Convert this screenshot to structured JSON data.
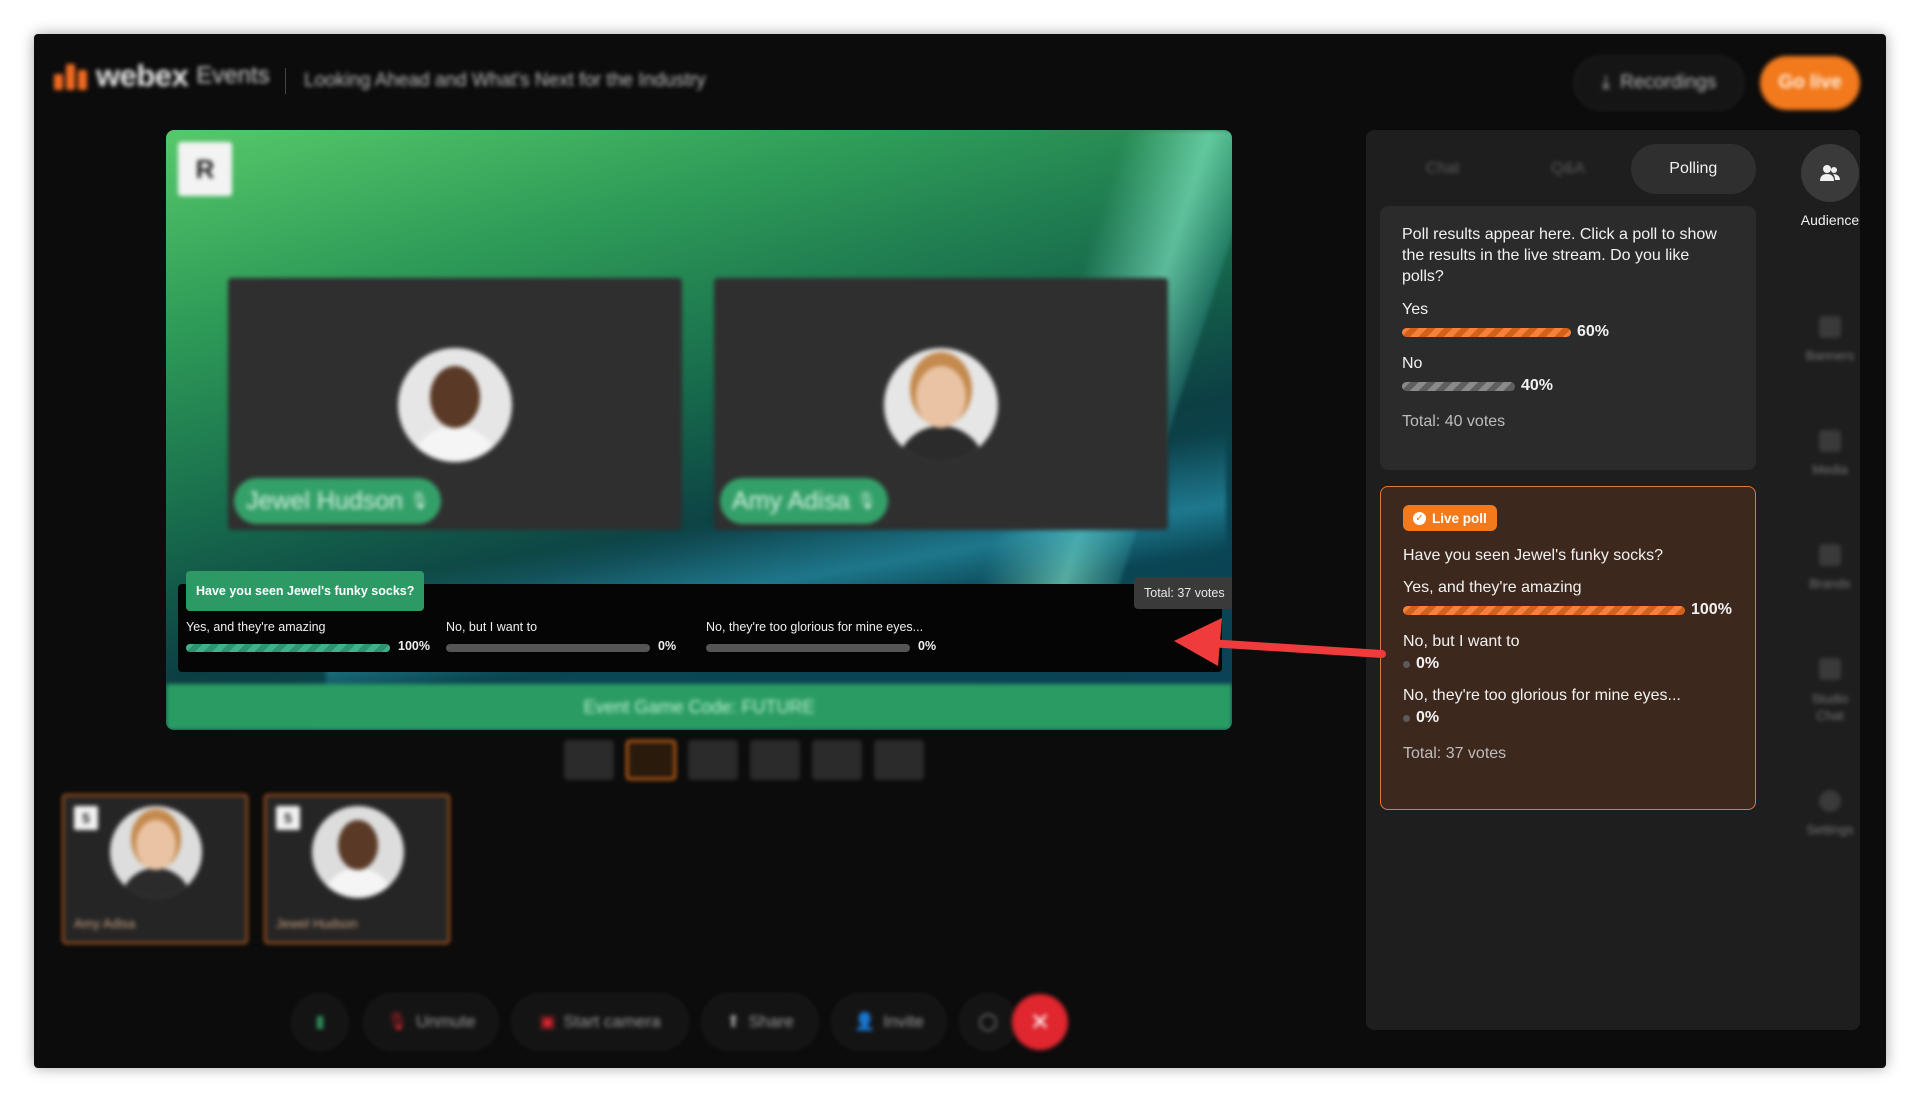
{
  "header": {
    "brand": "webex",
    "brand_suffix": "Events",
    "event_title": "Looking Ahead and What's Next for the Industry",
    "recordings_label": "Recordings",
    "go_live_label": "Go live"
  },
  "stage": {
    "presenters": [
      {
        "name": "Jewel Hudson"
      },
      {
        "name": "Amy Adisa"
      }
    ],
    "poll": {
      "question": "Have you seen Jewel's funky socks?",
      "total": "Total: 37 votes",
      "options": [
        {
          "label": "Yes, and they're amazing",
          "percent_label": "100%",
          "percent": 100
        },
        {
          "label": "No, but I want to",
          "percent_label": "0%",
          "percent": 0
        },
        {
          "label": "No, they're too glorious for mine eyes...",
          "percent_label": "0%",
          "percent": 0
        }
      ]
    },
    "game_code": "Event Game Code: FUTURE"
  },
  "thumbnails": [
    {
      "number": "5",
      "name": "Amy Adisa"
    },
    {
      "number": "5",
      "name": "Jewel Hudson"
    }
  ],
  "controls": {
    "unmute": "Unmute",
    "start_camera": "Start camera",
    "share": "Share",
    "invite": "Invite"
  },
  "panel": {
    "tabs": [
      {
        "label": "Chat",
        "active": false
      },
      {
        "label": "Q&A",
        "active": false
      },
      {
        "label": "Polling",
        "active": true
      }
    ],
    "results_poll": {
      "description": "Poll results appear here. Click a poll to show the results in the live stream. Do you like polls?",
      "options": [
        {
          "label": "Yes",
          "percent_label": "60%",
          "percent": 60
        },
        {
          "label": "No",
          "percent_label": "40%",
          "percent": 40
        }
      ],
      "total": "Total: 40 votes"
    },
    "live_poll": {
      "badge": "Live poll",
      "question": "Have you seen Jewel's funky socks?",
      "options": [
        {
          "label": "Yes, and they're amazing",
          "percent_label": "100%",
          "percent": 100
        },
        {
          "label": "No, but I want to",
          "percent_label": "0%",
          "percent": 0
        },
        {
          "label": "No, they're too glorious for mine eyes...",
          "percent_label": "0%",
          "percent": 0
        }
      ],
      "total": "Total: 37 votes"
    }
  },
  "rail": {
    "audience": "Audience",
    "banners": "Banners",
    "media": "Media",
    "brands": "Brands",
    "studio_chat": "Studio Chat",
    "settings": "Settings"
  },
  "colors": {
    "accent_orange": "#f2791c",
    "stage_green": "#2a9c63",
    "end_red": "#e0262e"
  }
}
